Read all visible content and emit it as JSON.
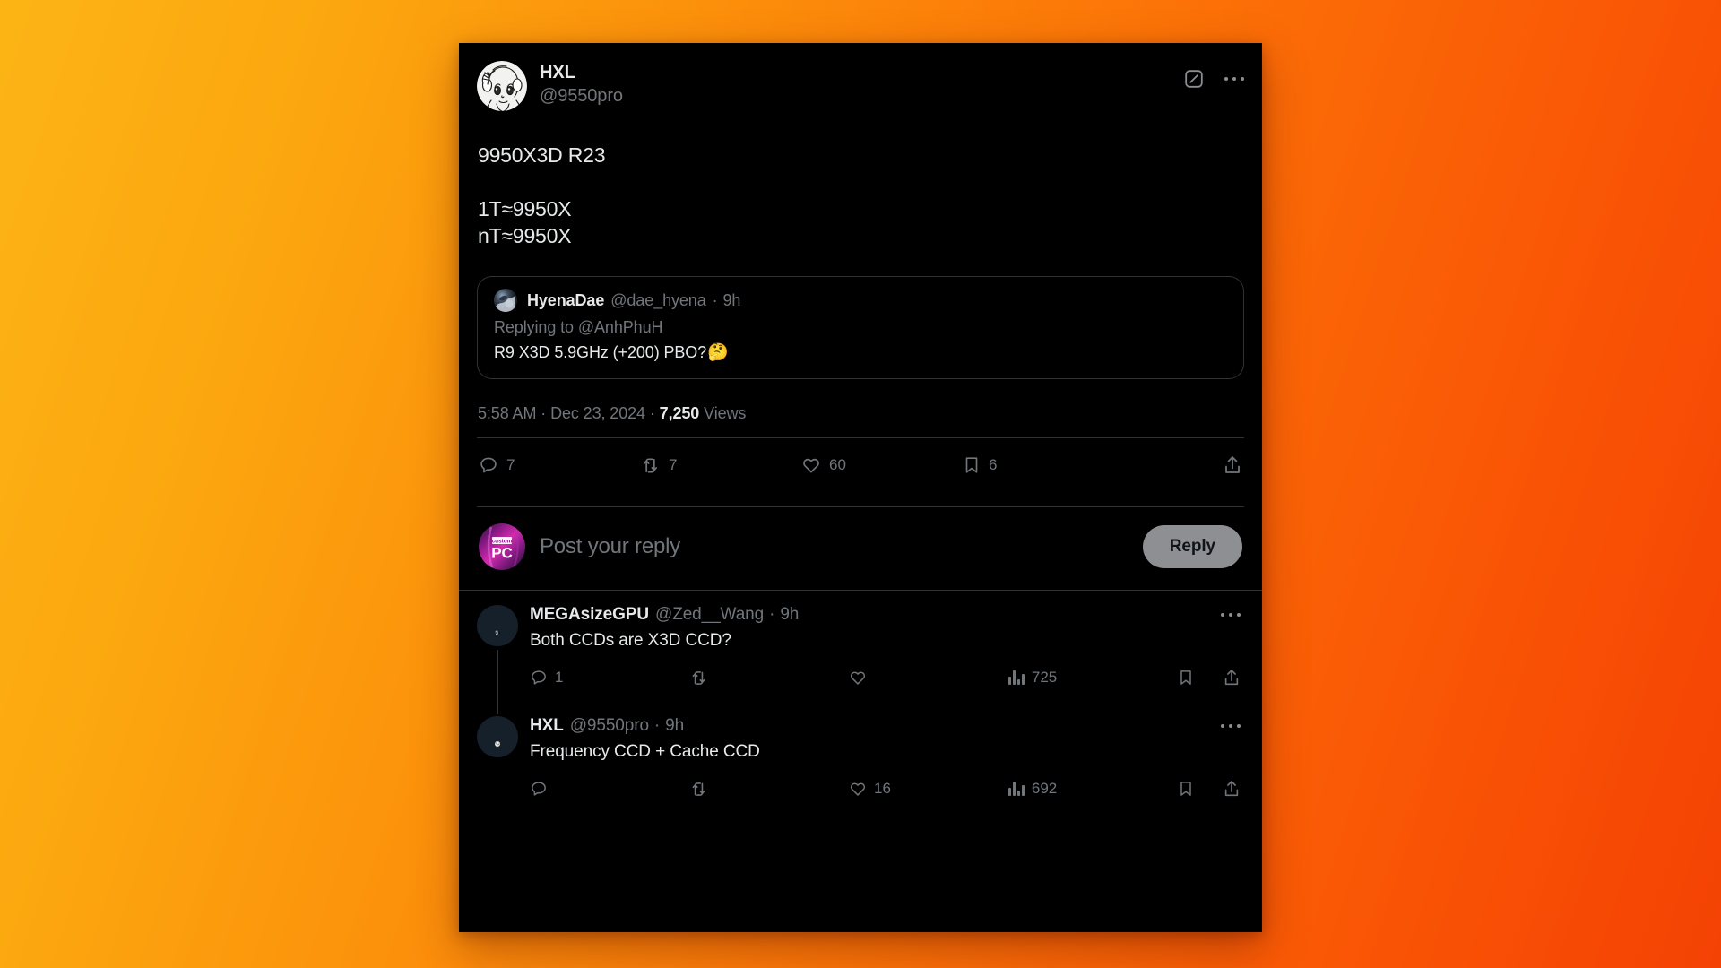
{
  "background": {
    "gradient_from": "#FCB415",
    "gradient_to": "#F44204"
  },
  "colors": {
    "card_bg": "#000000",
    "text_primary": "#E7E9EA",
    "text_muted": "#71767B",
    "border": "#2F3336",
    "reply_button_bg": "#8D8F92"
  },
  "main_post": {
    "author": {
      "display_name": "HXL",
      "handle": "@9550pro",
      "avatar_name": "hxl-anime-avatar"
    },
    "header_icons": {
      "expand_label": "grok-actions-icon",
      "more_label": "more-options-icon"
    },
    "body_text": "9950X3D R23\n\n1T≈9950X\nnT≈9950X",
    "quoted_post": {
      "display_name": "HyenaDae",
      "handle": "@dae_hyena",
      "separator": "·",
      "timestamp": "9h",
      "replying_to": "Replying to @AnhPhuH",
      "text": "R9 X3D 5.9GHz (+200) PBO?",
      "emoji": "🤔",
      "avatar_name": "hyenadae-avatar"
    },
    "metadata": {
      "time": "5:58 AM",
      "dot1": "·",
      "date": "Dec 23, 2024",
      "dot2": "·",
      "views_count": "7,250",
      "views_label": "Views"
    },
    "actions": [
      {
        "icon": "reply-icon",
        "count": "7"
      },
      {
        "icon": "retweet-icon",
        "count": "7"
      },
      {
        "icon": "like-icon",
        "count": "60"
      },
      {
        "icon": "bookmark-icon",
        "count": "6"
      },
      {
        "icon": "share-icon",
        "count": ""
      }
    ]
  },
  "composer": {
    "avatar_name": "custom-pc-logo-avatar",
    "avatar_text_top": "custom",
    "avatar_text_bottom": "PC",
    "placeholder": "Post your reply",
    "button_label": "Reply"
  },
  "replies": [
    {
      "display_name": "MEGAsizeGPU",
      "handle": "@Zed__Wang",
      "separator": "·",
      "timestamp": "9h",
      "text": "Both CCDs are X3D CCD?",
      "avatar_name": "megasizegpu-avatar",
      "has_thread_line": true,
      "actions": [
        {
          "icon": "reply-icon",
          "count": "1"
        },
        {
          "icon": "retweet-icon",
          "count": ""
        },
        {
          "icon": "like-icon",
          "count": ""
        },
        {
          "icon": "views-icon",
          "count": "725"
        },
        {
          "icon": "bookmark-icon",
          "count": ""
        },
        {
          "icon": "share-icon",
          "count": ""
        }
      ]
    },
    {
      "display_name": "HXL",
      "handle": "@9550pro",
      "separator": "·",
      "timestamp": "9h",
      "text": "Frequency CCD + Cache CCD",
      "avatar_name": "hxl-anime-avatar",
      "has_thread_line": false,
      "actions": [
        {
          "icon": "reply-icon",
          "count": ""
        },
        {
          "icon": "retweet-icon",
          "count": ""
        },
        {
          "icon": "like-icon",
          "count": "16"
        },
        {
          "icon": "views-icon",
          "count": "692"
        },
        {
          "icon": "bookmark-icon",
          "count": ""
        },
        {
          "icon": "share-icon",
          "count": ""
        }
      ]
    }
  ]
}
